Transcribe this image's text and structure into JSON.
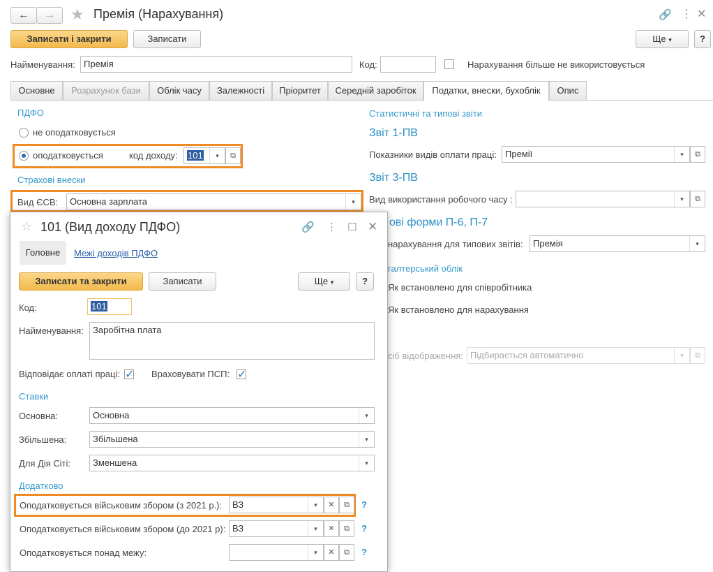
{
  "window": {
    "title": "Премія (Нарахування)"
  },
  "toolbar": {
    "save_close": "Записати і закрити",
    "save": "Записати",
    "more": "Ще",
    "help": "?"
  },
  "form": {
    "name_label": "Найменування:",
    "name_value": "Премія",
    "code_label": "Код:",
    "code_value": "",
    "not_used_label": "Нарахування більше не використовується"
  },
  "tabs": [
    {
      "label": "Основне"
    },
    {
      "label": "Розрахунок бази"
    },
    {
      "label": "Облік часу"
    },
    {
      "label": "Залежності"
    },
    {
      "label": "Пріоритет"
    },
    {
      "label": "Середній заробіток"
    },
    {
      "label": "Податки, внески, бухоблік"
    },
    {
      "label": "Опис"
    }
  ],
  "pdfo": {
    "title": "ПДФО",
    "not_taxed": "не оподатковується",
    "taxed": "оподатковується",
    "income_code_label": "код доходу:",
    "income_code_value": "101"
  },
  "insurance": {
    "title": "Страхові внески",
    "esv_label": "Вид ЄСВ:",
    "esv_value": "Основна зарплата"
  },
  "stats": {
    "title": "Статистичні та типові звіти",
    "report1": "Звіт 1-ПВ",
    "pay_types_label": "Показники видів оплати праці:",
    "pay_types_value": "Премії",
    "report3": "Звіт 3-ПВ",
    "work_time_label": "Вид використання робочого часу :",
    "work_time_value": "",
    "forms_p6": "ові форми П-6, П-7",
    "accrual_label": "нарахування для типових звітів:",
    "accrual_value": "Премія",
    "accounting_title": "галтерський облік",
    "as_employee": "Як встановлено для співробітника",
    "as_accrual": "Як встановлено для нарахування",
    "display_label": "сіб відображення:",
    "display_value": "Підбирається автоматично"
  },
  "dialog": {
    "title": "101 (Вид доходу ПДФО)",
    "tab_main": "Головне",
    "tab_limits": "Межі доходів ПДФО",
    "save_close": "Записати та закрити",
    "save": "Записати",
    "more": "Ще",
    "help": "?",
    "code_label": "Код:",
    "code_value": "101",
    "name_label": "Найменування:",
    "name_value": "Заробітна плата",
    "corresponds_label": "Відповідає оплаті праці:",
    "psp_label": "Враховувати ПСП:",
    "rates_title": "Ставки",
    "basic_label": "Основна:",
    "basic_value": "Основна",
    "increased_label": "Збільшена:",
    "increased_value": "Збільшена",
    "diya_label": "Для Дія Сіті:",
    "diya_value": "Зменшена",
    "extra_title": "Додатково",
    "military2021_label": "Оподатковується військовим збором (з 2021 р.):",
    "military2021_value": "ВЗ",
    "militaryBefore_label": "Оподатковується військовим збором (до 2021 р):",
    "militaryBefore_value": "ВЗ",
    "above_limit_label": "Оподатковується понад межу:",
    "above_limit_value": "",
    "q": "?"
  }
}
